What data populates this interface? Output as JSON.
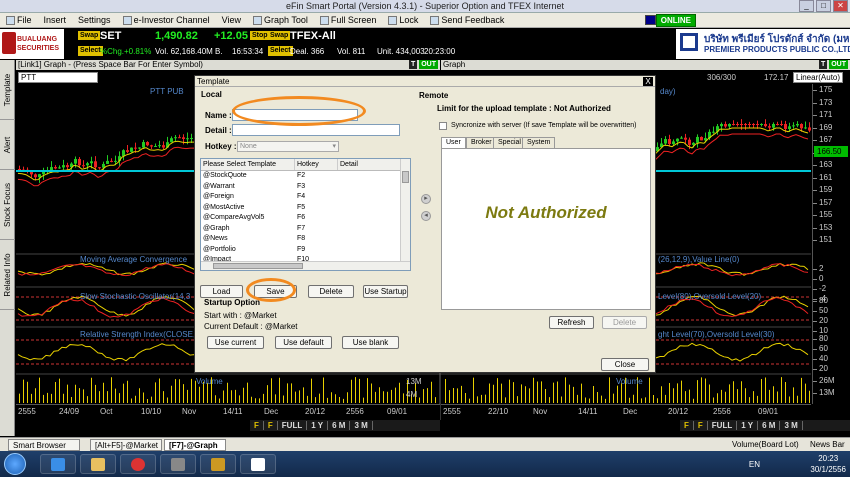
{
  "window": {
    "title": "eFin Smart Portal (Version 4.3.1) - Superior Option and TFEX Internet"
  },
  "menu": {
    "items": [
      "File",
      "Insert",
      "Settings",
      "e-Investor Channel",
      "View",
      "Graph Tool",
      "Full Screen",
      "Lock",
      "Send Feedback"
    ],
    "online": "ONLINE"
  },
  "broker_logo": {
    "line1": "BUALUANG",
    "line2": "SECURITIES"
  },
  "company_logo": {
    "line1": "บริษัท พรีเมียร์ โปรดักส์ จำกัด (มหาชน)",
    "line2": "PREMIER PRODUCTS PUBLIC CO.,LTD."
  },
  "ticker": {
    "swap": "Swap",
    "select": "Select",
    "stop": "Stop",
    "set": {
      "name": "SET",
      "value": "1,490.82",
      "change": "+12.05",
      "pct": "%Chg.+0.81%",
      "vol": "Vol. 62,168.40M B.",
      "time": "16:53:34"
    },
    "tfex": {
      "name": "TFEX-All",
      "deal": "Deal. 366",
      "vol": "Vol. 811",
      "oi": "Unit. 434,003",
      "time": "20:23:00"
    }
  },
  "left_tabs": [
    "Template",
    "Alert",
    "Stock Focus",
    "Related Info"
  ],
  "left_panel": {
    "header": "[Link1] Graph - (Press Space Bar For Enter Symbol)",
    "symbol": "PTT",
    "title_partial": "PTT PUB",
    "controls": [
      "T",
      "OUT"
    ],
    "indicators": [
      "Moving Average Convergence",
      "Slow Stochastic Oscillator(14,3",
      "Relative Strength Index(CLOSE,14,3",
      "Volume"
    ],
    "vol_labels": [
      "13M",
      "4M"
    ],
    "dates": [
      "2555",
      "24/09",
      "Oct",
      "10/10",
      "Nov",
      "14/11",
      "Dec",
      "20/12",
      "2556",
      "09/01"
    ],
    "toolbar": [
      "F",
      "F",
      "FULL",
      "1 Y",
      "6 M",
      "3 M"
    ]
  },
  "right_panel": {
    "header": "Graph",
    "info": [
      "306/300",
      "172.17"
    ],
    "scale": "Linear(Auto)",
    "title_partial": "day)",
    "controls": [
      "T",
      "OUT"
    ],
    "indicators": [
      "(26,12,9),Value Line(0)",
      "Level(80),Oversold Level(20)",
      "ght Level(70),Oversold Level(30)",
      "Volume"
    ],
    "vol_labels": [
      "26M",
      "13M"
    ],
    "dates": [
      "2555",
      "22/10",
      "Nov",
      "14/11",
      "Dec",
      "20/12",
      "2556",
      "09/01"
    ],
    "toolbar": [
      "F",
      "F",
      "FULL",
      "1 Y",
      "6 M",
      "3 M"
    ],
    "price_labels": [
      "175",
      "173",
      "171",
      "169",
      "167",
      "165",
      "163",
      "161",
      "159",
      "157",
      "155",
      "153",
      "151"
    ],
    "current_price": "166.50",
    "macd_labels": [
      "2",
      "0",
      "-2",
      "-4"
    ],
    "sto_labels": [
      "80",
      "50",
      "20",
      "10"
    ],
    "rsi_labels": [
      "80",
      "60",
      "40",
      "20"
    ]
  },
  "dialog": {
    "title": "Template",
    "close": "X",
    "local": "Local",
    "name_label": "Name :",
    "detail_label": "Detail :",
    "hotkey_label": "Hotkey :",
    "hotkey_value": "None",
    "list_headers": [
      "Please Select Template",
      "Hotkey",
      "Detail"
    ],
    "templates": [
      {
        "name": "@StockQuote",
        "hotkey": "F2"
      },
      {
        "name": "@Warrant",
        "hotkey": "F3"
      },
      {
        "name": "@Foreign",
        "hotkey": "F4"
      },
      {
        "name": "@MostActive",
        "hotkey": "F5"
      },
      {
        "name": "@CompareAvgVol5",
        "hotkey": "F6"
      },
      {
        "name": "@Graph",
        "hotkey": "F7"
      },
      {
        "name": "@News",
        "hotkey": "F8"
      },
      {
        "name": "@Portfolio",
        "hotkey": "F9"
      },
      {
        "name": "@Impact",
        "hotkey": "F10"
      }
    ],
    "buttons": {
      "load": "Load",
      "save": "Save",
      "delete": "Delete",
      "use_startup": "Use Startup"
    },
    "startup": {
      "title": "Startup Option",
      "start_with": "Start with :  @Market",
      "current_default": "Current Default :  @Market",
      "use_current": "Use current",
      "use_default": "Use default",
      "use_blank": "Use blank"
    },
    "remote": {
      "title": "Remote",
      "limit": "Limit for the upload template :  Not Authorized",
      "sync": "Syncronize with server  (If save Template will be overwritten)",
      "tabs": [
        "User",
        "Broker",
        "Special",
        "System"
      ],
      "message": "Not Authorized",
      "refresh": "Refresh",
      "delete": "Delete"
    },
    "close_btn": "Close"
  },
  "bottom_tabs": [
    "Smart Browser",
    "[Alt+F5]-@Market",
    "[F7]-@Graph"
  ],
  "status": {
    "left": "Volume(Board Lot)",
    "right": "News Bar"
  },
  "taskbar": {
    "lang": "EN",
    "time": "20:23",
    "date": "30/1/2556"
  }
}
